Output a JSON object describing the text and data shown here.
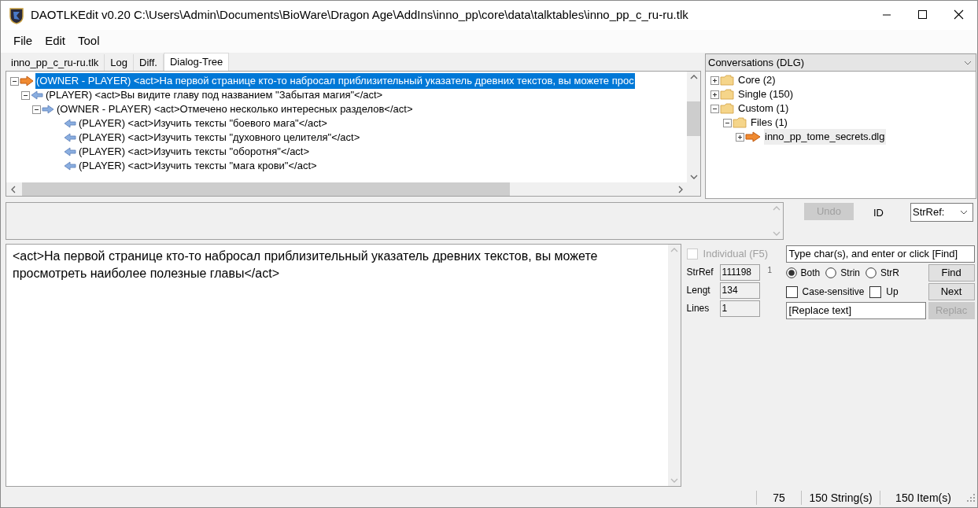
{
  "window": {
    "title": "DAOTLKEdit v0.20 C:\\Users\\Admin\\Documents\\BioWare\\Dragon Age\\AddIns\\inno_pp\\core\\data\\talktables\\inno_pp_c_ru-ru.tlk"
  },
  "menu": [
    "File",
    "Edit",
    "Tool"
  ],
  "tabs": [
    {
      "label": "inno_pp_c_ru-ru.tlk",
      "selected": false
    },
    {
      "label": "Log",
      "selected": false
    },
    {
      "label": "Diff.",
      "selected": false
    },
    {
      "label": "Dialog-Tree",
      "selected": true
    }
  ],
  "dialog_tree": [
    {
      "kind": "owner",
      "text": "(OWNER - PLAYER) <act>На первой странице кто-то набросал приблизительный указатель древних текстов, вы можете прос",
      "selected": true,
      "expanded": true,
      "children": [
        {
          "kind": "player",
          "text": "(PLAYER) <act>Вы видите главу под названием \"Забытая магия\"</act>",
          "selected": false,
          "expanded": true,
          "children": [
            {
              "kind": "link",
              "text": "(OWNER - PLAYER) <act>Отмечено несколько интересных разделов</act>",
              "selected": false,
              "expanded": true,
              "children": [
                {
                  "kind": "player",
                  "text": "(PLAYER) <act>Изучить тексты \"боевого мага\"</act>",
                  "selected": false
                },
                {
                  "kind": "player",
                  "text": "(PLAYER) <act>Изучить тексты \"духовного целителя\"</act>",
                  "selected": false
                },
                {
                  "kind": "player",
                  "text": "(PLAYER) <act>Изучить тексты \"оборотня\"</act>",
                  "selected": false
                },
                {
                  "kind": "player",
                  "text": "(PLAYER) <act>Изучить тексты \"мага крови\"</act>",
                  "selected": false
                }
              ]
            }
          ]
        }
      ]
    }
  ],
  "conversations": {
    "title": "Conversations (DLG)",
    "items": [
      {
        "kind": "folder",
        "label": "Core (2)",
        "expanded": false,
        "selected": false
      },
      {
        "kind": "folder",
        "label": "Single (150)",
        "expanded": false,
        "selected": false
      },
      {
        "kind": "folder",
        "label": "Custom (1)",
        "expanded": true,
        "selected": false,
        "children": [
          {
            "kind": "folder",
            "label": "Files (1)",
            "expanded": true,
            "selected": false,
            "children": [
              {
                "kind": "dialog",
                "label": "inno_pp_tome_secrets.dlg",
                "expanded": false,
                "selected": true
              }
            ]
          }
        ]
      }
    ]
  },
  "undo_button": {
    "label": "Undo",
    "disabled": true
  },
  "id_label": "ID",
  "id_select": {
    "value": "StrRef:"
  },
  "editor": {
    "value": "<act>На первой странице кто-то набросал приблизительный указатель древних текстов, вы можете просмотреть наиболее полезные главы</act>"
  },
  "individual": {
    "label": "Individual (F5)",
    "checked": false,
    "disabled": true
  },
  "fields": [
    {
      "label": "StrRef",
      "value": "111198"
    },
    {
      "label": "Lengt",
      "value": "134"
    },
    {
      "label": "Lines",
      "value": "1"
    }
  ],
  "line_marker": "1",
  "search": {
    "value": "Type char(s), and enter or click [Find]"
  },
  "scope_options": [
    {
      "label": "Both",
      "selected": true
    },
    {
      "label": "Strin",
      "selected": false
    },
    {
      "label": "StrR",
      "selected": false
    }
  ],
  "options": [
    {
      "label": "Case-sensitive",
      "checked": false
    },
    {
      "label": "Up",
      "checked": false
    }
  ],
  "buttons": [
    {
      "label": "Find",
      "disabled": false
    },
    {
      "label": "Next",
      "disabled": false
    },
    {
      "label": "Replac",
      "disabled": true
    }
  ],
  "replace": {
    "value": "[Replace text]"
  },
  "status_bar": [
    "75",
    "150 String(s)",
    "150 Item(s)"
  ]
}
